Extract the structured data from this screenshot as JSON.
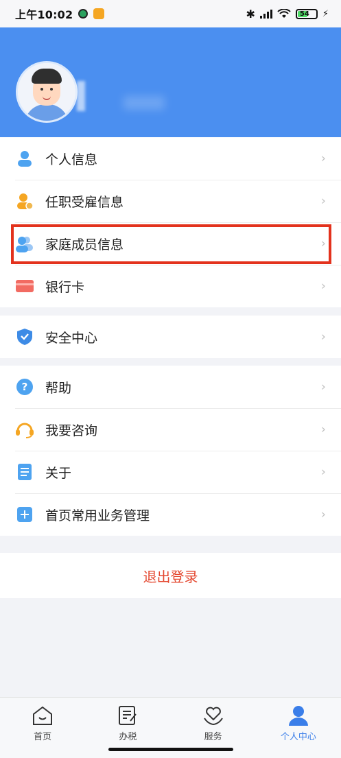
{
  "status_bar": {
    "time": "上午10:02",
    "battery": "54"
  },
  "menu_group_1": [
    {
      "label": "个人信息",
      "icon": "person-icon"
    },
    {
      "label": "任职受雇信息",
      "icon": "employment-icon"
    },
    {
      "label": "家庭成员信息",
      "icon": "family-icon"
    },
    {
      "label": "银行卡",
      "icon": "bank-card-icon"
    }
  ],
  "menu_group_2": [
    {
      "label": "安全中心",
      "icon": "shield-icon"
    }
  ],
  "menu_group_3": [
    {
      "label": "帮助",
      "icon": "help-icon"
    },
    {
      "label": "我要咨询",
      "icon": "headset-icon"
    },
    {
      "label": "关于",
      "icon": "document-icon"
    },
    {
      "label": "首页常用业务管理",
      "icon": "plus-icon"
    }
  ],
  "logout_label": "退出登录",
  "tabs": [
    {
      "label": "首页",
      "icon": "home-icon"
    },
    {
      "label": "办税",
      "icon": "edit-doc-icon"
    },
    {
      "label": "服务",
      "icon": "heart-hand-icon"
    },
    {
      "label": "个人中心",
      "icon": "user-icon"
    }
  ],
  "colors": {
    "header_blue": "#4b8ff0",
    "accent_red": "#e3321d",
    "tab_active": "#3a7ee9"
  }
}
